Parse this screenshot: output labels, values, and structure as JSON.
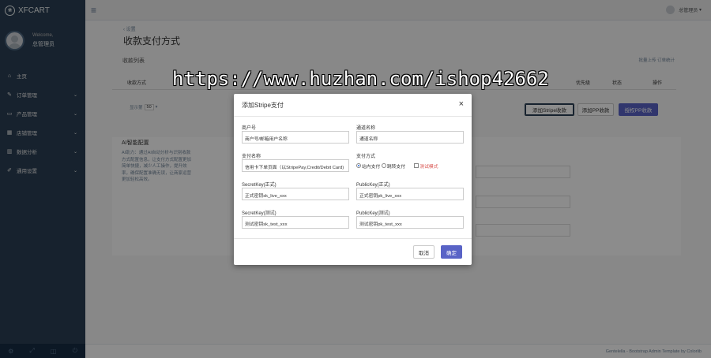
{
  "brand": {
    "logo_icon": "paw-icon",
    "name": "XFCART"
  },
  "profile": {
    "welcome": "Welcome,",
    "name": "总管理员"
  },
  "sidebar": {
    "items": [
      {
        "icon": "home-icon",
        "glyph": "⌂",
        "label": "主页",
        "has_children": false
      },
      {
        "icon": "edit-icon",
        "glyph": "✎",
        "label": "订单管理",
        "has_children": true
      },
      {
        "icon": "desktop-icon",
        "glyph": "▭",
        "label": "产品管理",
        "has_children": true
      },
      {
        "icon": "table-icon",
        "glyph": "▦",
        "label": "店铺管理",
        "has_children": true
      },
      {
        "icon": "bar-chart-icon",
        "glyph": "▥",
        "label": "数据分析",
        "has_children": true
      },
      {
        "icon": "wrench-icon",
        "glyph": "✐",
        "label": "通用设置",
        "has_children": true
      }
    ],
    "footer_icons": [
      {
        "name": "gear-icon",
        "glyph": "⚙"
      },
      {
        "name": "fullscreen-icon",
        "glyph": "⤢"
      },
      {
        "name": "eye-slash-icon",
        "glyph": "◫"
      },
      {
        "name": "logout-icon",
        "glyph": "⏻"
      }
    ]
  },
  "topnav": {
    "toggle_glyph": "≡",
    "user": "总管理员"
  },
  "page": {
    "back": "‹ 设置",
    "title": "收款支付方式",
    "list_title": "收款列表",
    "links": "批量上传  订单统计",
    "table_headers": [
      "收款方式",
      "优先级",
      "状态",
      "操作"
    ],
    "pager_prefix": "显示第",
    "pager_value": "50",
    "buttons": {
      "add_stripe": "添加Stripe收款",
      "add_pp": "添加PP收款",
      "ppay": "授权PP收款"
    },
    "ai_title": "AI智能配置",
    "ai_desc": "AI助力：通过AI自动分析与识别收款方式配置信息，让支付方式配置更加简单快捷，减少人工操作，提升效率，确保配置准确无误，让商家运营更加轻松高效。"
  },
  "modal": {
    "title": "添加Stripe支付",
    "close_glyph": "×",
    "fields": {
      "merchant": {
        "label": "商户号",
        "value": "商户号/邮箱用户名称"
      },
      "channel": {
        "label": "通道名称",
        "value": "通道名称"
      },
      "pay_name": {
        "label": "支付名称",
        "value": "信用卡下单页面（以StripePay,Credit/Debit Card)"
      },
      "pay_mode": {
        "label": "支付方式",
        "opt1": "站内支付",
        "opt2": "跳转支付",
        "checkbox": "测试模式"
      },
      "secret_live": {
        "label": "SecretKey(正式)",
        "value": "正式密钥sk_live_xxx"
      },
      "public_live": {
        "label": "PublicKey(正式)",
        "value": "正式密钥pk_live_xxx"
      },
      "secret_test": {
        "label": "SecretKey(测试)",
        "value": "测试密钥sk_test_xxx"
      },
      "public_test": {
        "label": "PublicKey(测试)",
        "value": "测试密钥pk_test_xxx"
      }
    },
    "cancel": "取消",
    "ok": "确定"
  },
  "footer": {
    "text": "Gentelella - Bootstrap Admin Template by Colorlib"
  },
  "watermark": "https://www.huzhan.com/ishop42662"
}
